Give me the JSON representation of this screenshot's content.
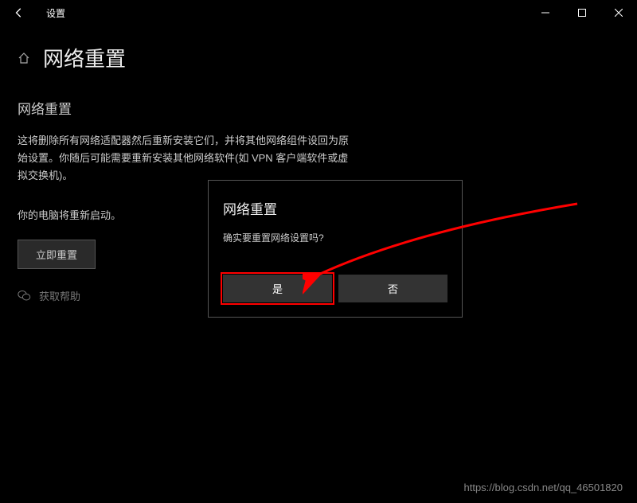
{
  "titlebar": {
    "title": "设置"
  },
  "header": {
    "page_title": "网络重置"
  },
  "main": {
    "section_heading": "网络重置",
    "description": "这将删除所有网络适配器然后重新安装它们，并将其他网络组件设回为原始设置。你随后可能需要重新安装其他网络软件(如 VPN 客户端软件或虚拟交换机)。",
    "restart_text": "你的电脑将重新启动。",
    "reset_button": "立即重置",
    "help_link": "获取帮助"
  },
  "dialog": {
    "title": "网络重置",
    "message": "确实要重置网络设置吗?",
    "yes": "是",
    "no": "否"
  },
  "watermark": "https://blog.csdn.net/qq_46501820"
}
